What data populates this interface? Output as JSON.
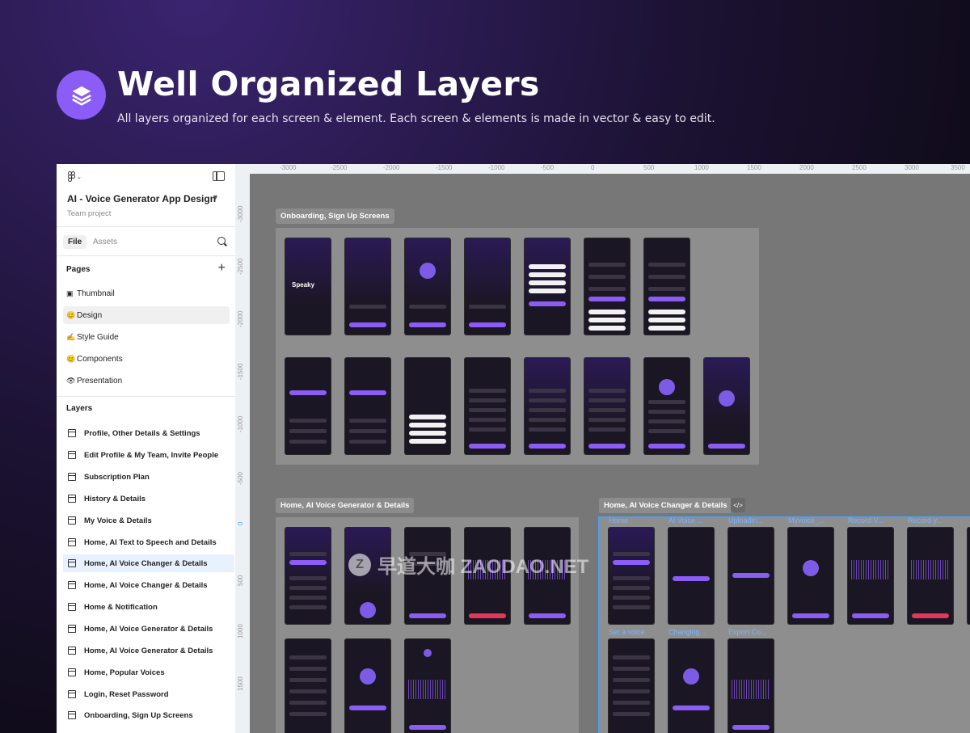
{
  "hero": {
    "title": "Well Organized Layers",
    "subtitle": "All layers organized for each screen & element. Each screen & elements is made in vector & easy to edit.",
    "icon": "layers-icon",
    "accent": "#8b5cf6"
  },
  "sidebar": {
    "project_name": "AI - Voice Generator App Design",
    "team": "Team project",
    "tabs": [
      "File",
      "Assets"
    ],
    "pages_title": "Pages",
    "pages": [
      {
        "emoji": "▣",
        "label": "Thumbnail"
      },
      {
        "emoji": "😊",
        "label": "Design"
      },
      {
        "emoji": "✍",
        "label": "Style Guide"
      },
      {
        "emoji": "😊",
        "label": "Components"
      },
      {
        "emoji": "👁",
        "label": "Presentation"
      }
    ],
    "layers_title": "Layers",
    "layers": [
      "Profile, Other Details & Settings",
      "Edit Profile & My Team, Invite People",
      "Subscription Plan",
      "History & Details",
      "My Voice & Details",
      "Home, AI Text to Speech and Details",
      "Home, AI Voice Changer & Details",
      "Home, AI Voice Changer & Details",
      "Home & Notification",
      "Home, AI Voice Generator & Details",
      "Home, AI Voice Generator & Details",
      "Home, Popular Voices",
      "Login, Reset Password",
      "Onboarding, Sign Up Screens"
    ]
  },
  "canvas": {
    "ruler_top": [
      "-3000",
      "-2500",
      "-2000",
      "-1500",
      "-1000",
      "-500",
      "0",
      "500",
      "1000",
      "1500",
      "2000",
      "2500",
      "3000",
      "3500"
    ],
    "ruler_left": [
      "-3000",
      "-2500",
      "-2000",
      "-1500",
      "-1000",
      "-500",
      "0",
      "500",
      "1000",
      "1500"
    ],
    "sections": [
      "Onboarding, Sign Up Screens",
      "Home, AI Voice Generator & Details",
      "Home, AI Voice Changer & Details"
    ],
    "code_button": "</>",
    "frame_names": [
      "Home",
      "AI Voice ...",
      "Uploadin...",
      "Myvoice_...",
      "Record V...",
      "Record y...",
      "Set a voice",
      "Changing...",
      "Export Co..."
    ],
    "brand": "Speaky",
    "watermark": "早道大咖 ZAODAO.NET"
  }
}
